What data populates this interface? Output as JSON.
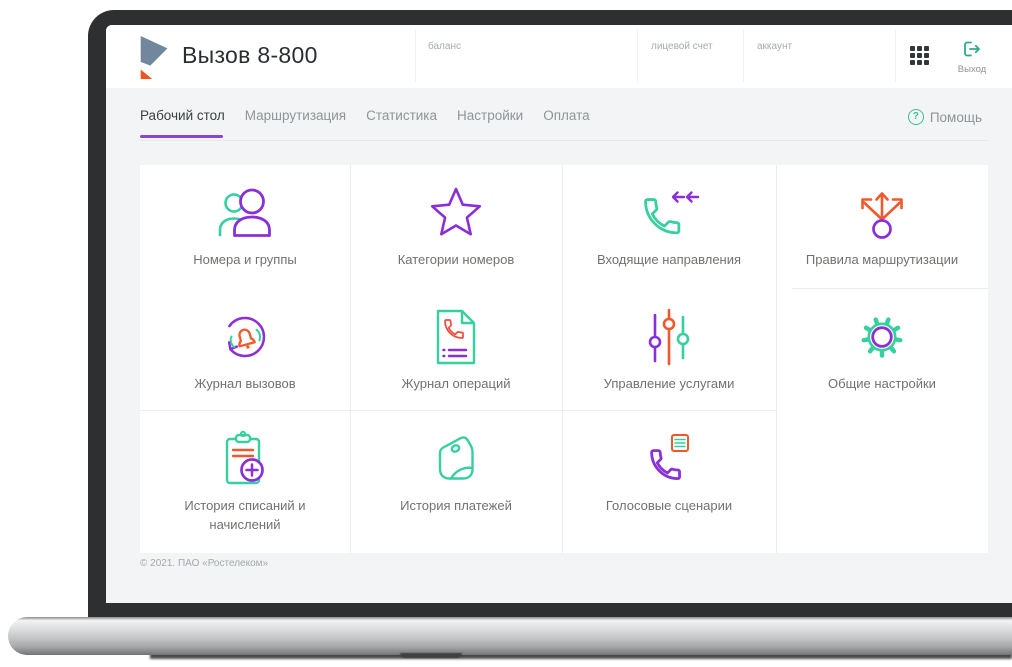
{
  "header": {
    "logo_icon": "rostelecom-logo",
    "title": "Вызов 8-800",
    "balance_label": "баланс",
    "personal_account_label": "лицевой счет",
    "account_label": "аккаунт",
    "apps_icon": "apps-grid-icon",
    "logout": {
      "icon": "logout-icon",
      "label": "Выход"
    }
  },
  "nav": {
    "tabs": [
      {
        "label": "Рабочий стол",
        "active": true
      },
      {
        "label": "Маршрутизация",
        "active": false
      },
      {
        "label": "Статистика",
        "active": false
      },
      {
        "label": "Настройки",
        "active": false
      },
      {
        "label": "Оплата",
        "active": false
      }
    ],
    "help": {
      "icon": "question-circle-icon",
      "icon_glyph": "?",
      "label": "Помощь"
    }
  },
  "tiles": [
    {
      "label": "Номера и группы",
      "icon": "users-icon"
    },
    {
      "label": "Категории номеров",
      "icon": "star-icon"
    },
    {
      "label": "Входящие направления",
      "icon": "incoming-call-icon"
    },
    {
      "label": "Правила маршрутизации",
      "icon": "routing-arrows-icon"
    },
    {
      "label": "Журнал вызовов",
      "icon": "call-log-bell-icon"
    },
    {
      "label": "Журнал операций",
      "icon": "operations-log-icon"
    },
    {
      "label": "Управление услугами",
      "icon": "sliders-icon"
    },
    {
      "label": "Общие настройки",
      "icon": "gear-icon"
    },
    {
      "label": "История списаний и\nначислений",
      "icon": "clipboard-plus-icon"
    },
    {
      "label": "История платежей",
      "icon": "wallet-icon"
    },
    {
      "label": "Голосовые сценарии",
      "icon": "voice-script-icon"
    }
  ],
  "footer": {
    "copyright": "© 2021. ПАО «Ростелеком»"
  },
  "colors": {
    "purple": "#8b2fd9",
    "green": "#36d0a0",
    "orange": "#f1582a",
    "red": "#ef4b3c",
    "teal": "#2fa98e",
    "active_tab_underline": "#8a46d2",
    "page_background": "#f3f4f6"
  }
}
